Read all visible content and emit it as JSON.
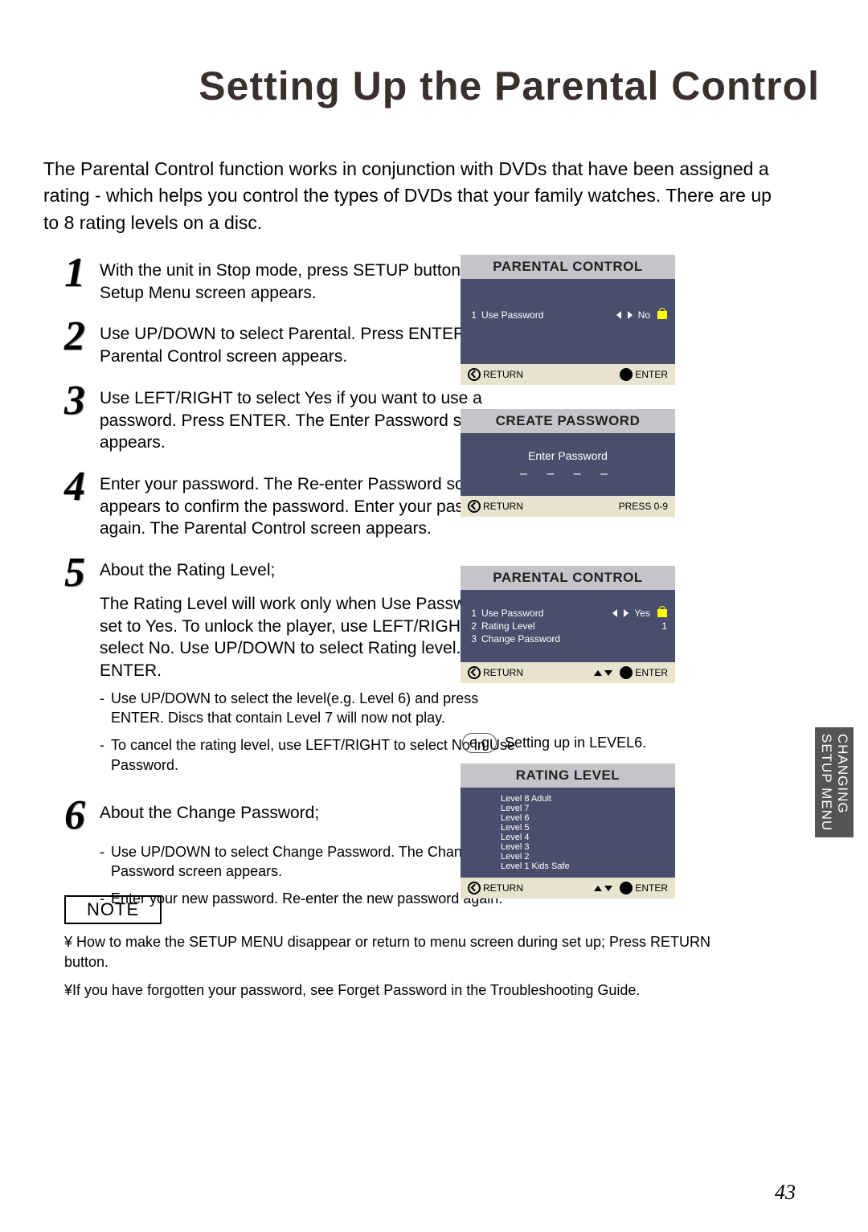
{
  "title": "Setting Up the Parental Control",
  "intro": "The Parental Control function works in conjunction with DVDs that have been assigned a rating - which helps you control the types of DVDs that your family watches. There are up to 8 rating levels on a disc.",
  "steps": [
    {
      "n": "1",
      "text": "With the unit in Stop mode, press SETUP button. The Setup Menu screen appears."
    },
    {
      "n": "2",
      "text": "Use UP/DOWN to select Parental. Press ENTER. The Parental Control screen appears."
    },
    {
      "n": "3",
      "text": "Use LEFT/RIGHT to select Yes if you want to use a password. Press ENTER. The Enter Password screen appears."
    },
    {
      "n": "4",
      "text": "Enter your password. The Re-enter Password screen appears to confirm the password. Enter your password again. The Parental Control screen appears."
    },
    {
      "n": "5",
      "text": "About the Rating Level;",
      "extra": "The Rating Level will work only when Use Password is set to Yes. To unlock the player, use LEFT/RIGHT to select No. Use UP/DOWN to select Rating level. Press ENTER.",
      "subs": [
        "Use UP/DOWN to select the level(e.g. Level 6) and press ENTER. Discs that contain Level 7 will now not play.",
        "To cancel the rating level, use LEFT/RIGHT to select No in Use Password."
      ]
    },
    {
      "n": "6",
      "text": "About the Change Password;",
      "subs": [
        "Use UP/DOWN to select Change Password. The Change Password screen appears.",
        "Enter your new password. Re-enter the new password again."
      ]
    }
  ],
  "note_label": "NOTE",
  "notes": [
    "¥ How to make the SETUP MENU disappear or return to menu screen during set up; Press RETURN button.",
    "¥If you have forgotten your password, see Forget Password in the Troubleshooting Guide."
  ],
  "sidetab": {
    "line1": "CHANGING",
    "line2": "SETUP MENU"
  },
  "buttons": {
    "return": "RETURN",
    "enter": "ENTER",
    "press09": "PRESS 0-9"
  },
  "eg": {
    "label": "e.g",
    "text": "Setting up in LEVEL6."
  },
  "osd1": {
    "title": "PARENTAL CONTROL",
    "row_n": "1",
    "row_label": "Use Password",
    "row_value": "No"
  },
  "osd2": {
    "title": "CREATE PASSWORD",
    "label": "Enter Password",
    "dashes": "– – – –"
  },
  "osd3": {
    "title": "PARENTAL CONTROL",
    "rows": [
      {
        "n": "1",
        "label": "Use Password",
        "value": "Yes",
        "arrows": true,
        "lock": true
      },
      {
        "n": "2",
        "label": "Rating Level",
        "value": "1"
      },
      {
        "n": "3",
        "label": "Change Password",
        "value": ""
      }
    ]
  },
  "osd4": {
    "title": "RATING  LEVEL",
    "levels": [
      "Level 8 Adult",
      "Level 7",
      "Level 6",
      "Level 5",
      "Level 4",
      "Level 3",
      "Level 2",
      "Level 1 Kids Safe"
    ]
  },
  "page_number": "43"
}
